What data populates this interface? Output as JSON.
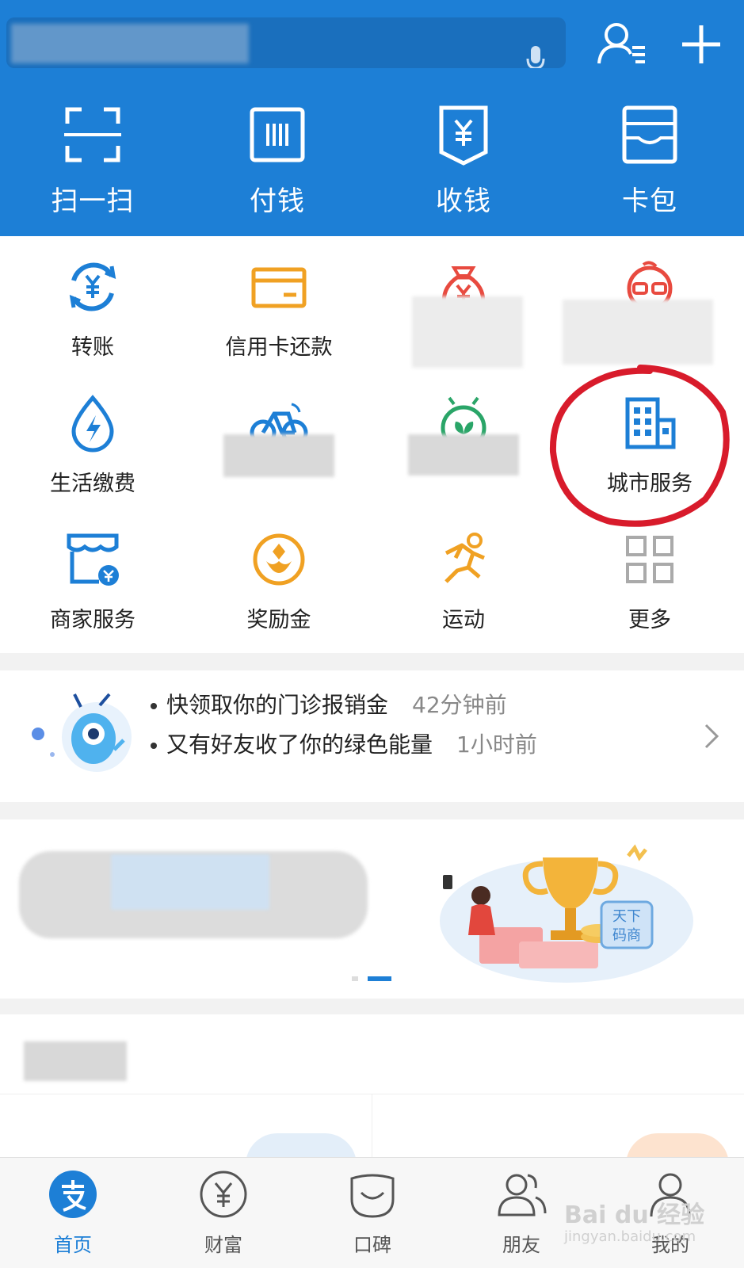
{
  "colors": {
    "brand_blue": "#1d7fd6",
    "orange": "#f0a123",
    "red": "#e84a3f",
    "green": "#2aa568",
    "annotation_red": "#d81b2b"
  },
  "header": {
    "search_icon": "mic-icon",
    "contacts_icon": "contacts-icon",
    "add_icon": "plus-icon"
  },
  "quick_actions": [
    {
      "label": "扫一扫",
      "icon": "scan-icon"
    },
    {
      "label": "付钱",
      "icon": "barcode-pay-icon"
    },
    {
      "label": "收钱",
      "icon": "receive-money-icon"
    },
    {
      "label": "卡包",
      "icon": "card-wallet-icon"
    }
  ],
  "grid": {
    "row1": [
      {
        "label": "转账",
        "icon": "transfer-icon"
      },
      {
        "label": "信用卡还款",
        "icon": "credit-card-icon"
      },
      {
        "label": "",
        "icon": "money-bag-icon"
      },
      {
        "label": "",
        "icon": "face-glasses-icon"
      }
    ],
    "row2": [
      {
        "label": "生活缴费",
        "icon": "utility-drop-icon"
      },
      {
        "label": "",
        "icon": "bicycle-icon"
      },
      {
        "label": "",
        "icon": "sprout-icon"
      },
      {
        "label": "城市服务",
        "icon": "city-building-icon"
      }
    ],
    "row3": [
      {
        "label": "商家服务",
        "icon": "merchant-shop-icon"
      },
      {
        "label": "奖励金",
        "icon": "reward-icon"
      },
      {
        "label": "运动",
        "icon": "running-icon"
      },
      {
        "label": "更多",
        "icon": "grid-more-icon"
      }
    ]
  },
  "notices": [
    {
      "text": "快领取你的门诊报销金",
      "time": "42分钟前"
    },
    {
      "text": "又有好友收了你的绿色能量",
      "time": "1小时前"
    }
  ],
  "banner": {
    "badge_text": "天下\n码商"
  },
  "tabs": [
    {
      "label": "首页",
      "icon": "alipay-logo-icon",
      "active": true
    },
    {
      "label": "财富",
      "icon": "wealth-icon",
      "active": false
    },
    {
      "label": "口碑",
      "icon": "koubei-icon",
      "active": false
    },
    {
      "label": "朋友",
      "icon": "friends-icon",
      "active": false
    },
    {
      "label": "我的",
      "icon": "me-icon",
      "active": false
    }
  ],
  "watermark": {
    "line1": "Bai du 经验",
    "line2": "jingyan.baidu.com"
  }
}
